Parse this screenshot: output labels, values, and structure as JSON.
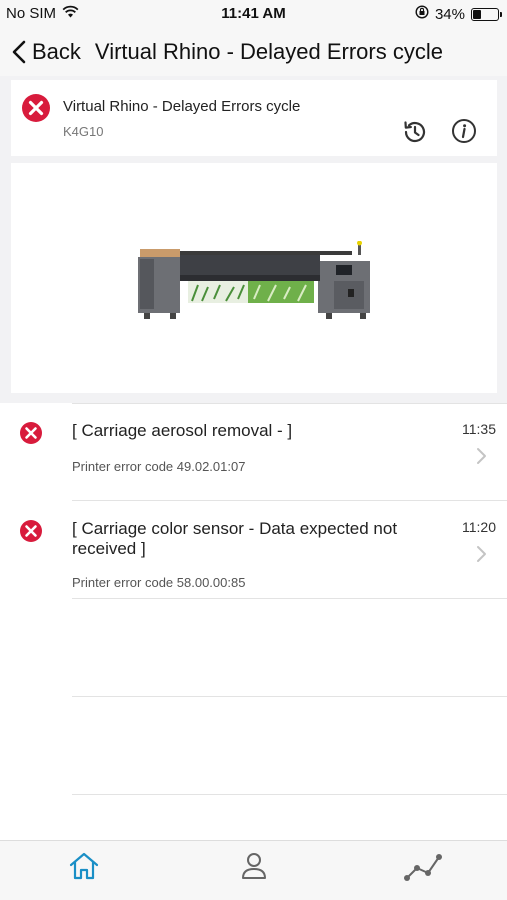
{
  "status_bar": {
    "carrier": "No SIM",
    "time": "11:41 AM",
    "battery_percent": "34%",
    "battery_level": 0.34
  },
  "nav": {
    "back_label": "Back",
    "title": "Virtual Rhino - Delayed Errors cycle"
  },
  "printer": {
    "name": "Virtual Rhino - Delayed Errors cycle",
    "model": "K4G10",
    "status": "error",
    "image_icon": "large-format-printer"
  },
  "errors": [
    {
      "title": "[ Carriage aerosol removal -  ]",
      "code": "Printer error code 49.02.01:07",
      "time": "11:35"
    },
    {
      "title": "[ Carriage color sensor - Data expected not received ]",
      "code": "Printer error code 58.00.00:85",
      "time": "11:20"
    }
  ],
  "tabs": [
    {
      "name": "home",
      "icon": "home-icon",
      "active": true
    },
    {
      "name": "profile",
      "icon": "person-icon",
      "active": false
    },
    {
      "name": "analytics",
      "icon": "line-chart-icon",
      "active": false
    }
  ],
  "colors": {
    "error_red": "#d81b3c",
    "accent_blue": "#1a8fc6",
    "icon_gray": "#666666"
  }
}
